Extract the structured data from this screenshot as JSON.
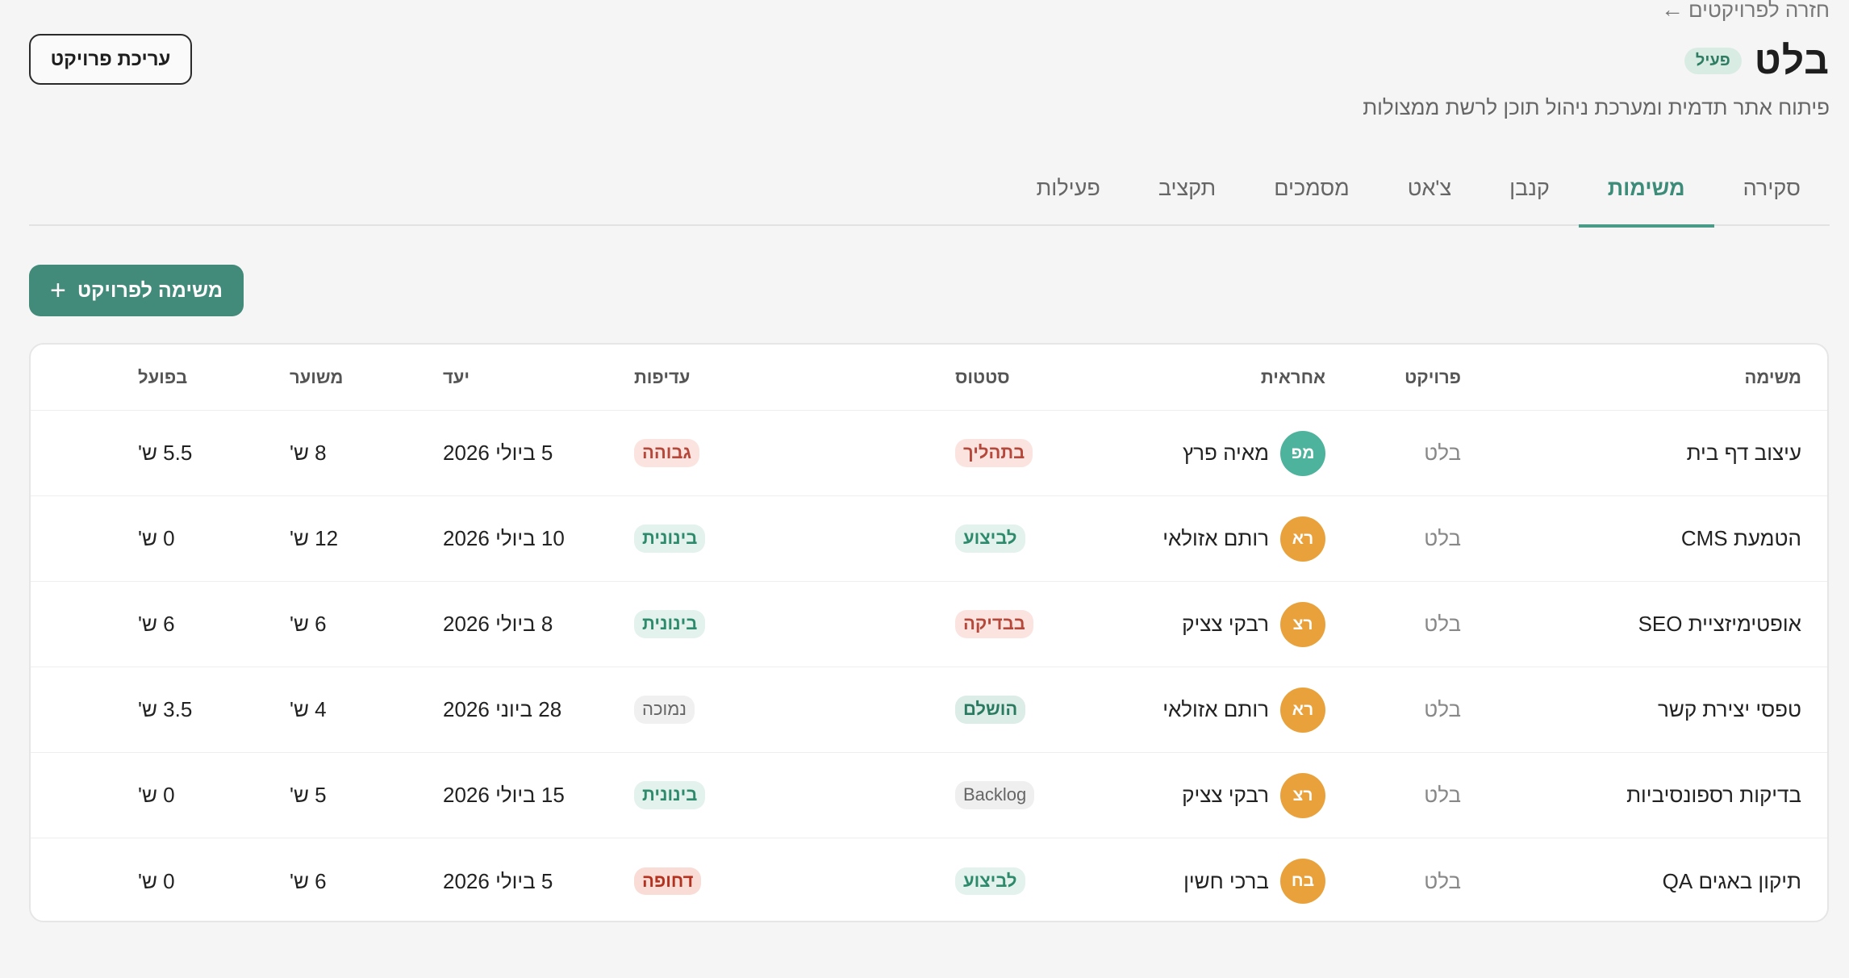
{
  "back_link": {
    "arrow": "←",
    "label": "חזרה לפרויקטים"
  },
  "project": {
    "title": "בלט",
    "status": "פעיל",
    "description": "פיתוח אתר תדמית ומערכת ניהול תוכן לרשת ממצולות",
    "edit_label": "עריכת פרויקט"
  },
  "tabs": [
    {
      "label": "סקירה"
    },
    {
      "label": "משימות",
      "active": true
    },
    {
      "label": "קנבן"
    },
    {
      "label": "צ'אט"
    },
    {
      "label": "מסמכים"
    },
    {
      "label": "תקציב"
    },
    {
      "label": "פעילות"
    }
  ],
  "add_task": {
    "icon": "plus-icon",
    "label": "משימה לפרויקט"
  },
  "table": {
    "columns": {
      "task": "משימה",
      "project": "פרויקט",
      "owner": "אחראית",
      "status": "סטטוס",
      "priority": "עדיפות",
      "due": "יעד",
      "estimate": "משוער",
      "actual": "בפועל"
    },
    "rows": [
      {
        "task": "עיצוב דף בית",
        "project": "בלט",
        "initials": "מפ",
        "avatar_color": "#4db39c",
        "owner": "מאיה פרץ",
        "status": "בתהליך",
        "status_class": "b-progress",
        "priority": "גבוהה",
        "priority_class": "p-high",
        "due": "5 ביולי 2026",
        "estimate": "8 ש'",
        "actual": "5.5 ש'"
      },
      {
        "task": "הטמעת CMS",
        "project": "בלט",
        "initials": "רא",
        "avatar_color": "#e9a23b",
        "owner": "רותם אזולאי",
        "status": "לביצוע",
        "status_class": "b-doing",
        "priority": "בינונית",
        "priority_class": "p-med",
        "due": "10 ביולי 2026",
        "estimate": "12 ש'",
        "actual": "0 ש'"
      },
      {
        "task": "אופטימיזציית SEO",
        "project": "בלט",
        "initials": "רצ",
        "avatar_color": "#e9a23b",
        "owner": "רבקי צציק",
        "status": "בבדיקה",
        "status_class": "b-review",
        "priority": "בינונית",
        "priority_class": "p-med",
        "due": "8 ביולי 2026",
        "estimate": "6 ש'",
        "actual": "6 ש'"
      },
      {
        "task": "טפסי יצירת קשר",
        "project": "בלט",
        "initials": "רא",
        "avatar_color": "#e9a23b",
        "owner": "רותם אזולאי",
        "status": "הושלם",
        "status_class": "b-done",
        "priority": "נמוכה",
        "priority_class": "p-low",
        "due": "28 ביוני 2026",
        "estimate": "4 ש'",
        "actual": "3.5 ש'"
      },
      {
        "task": "בדיקות רספונסיביות",
        "project": "בלט",
        "initials": "רצ",
        "avatar_color": "#e9a23b",
        "owner": "רבקי צציק",
        "status": "Backlog",
        "status_class": "b-backlog",
        "priority": "בינונית",
        "priority_class": "p-med",
        "due": "15 ביולי 2026",
        "estimate": "5 ש'",
        "actual": "0 ש'"
      },
      {
        "task": "תיקון באגים QA",
        "project": "בלט",
        "initials": "בח",
        "avatar_color": "#e9a23b",
        "owner": "ברכי חשין",
        "status": "לביצוע",
        "status_class": "b-doing",
        "priority": "דחופה",
        "priority_class": "p-urgent",
        "due": "5 ביולי 2026",
        "estimate": "6 ש'",
        "actual": "0 ש'"
      }
    ]
  }
}
